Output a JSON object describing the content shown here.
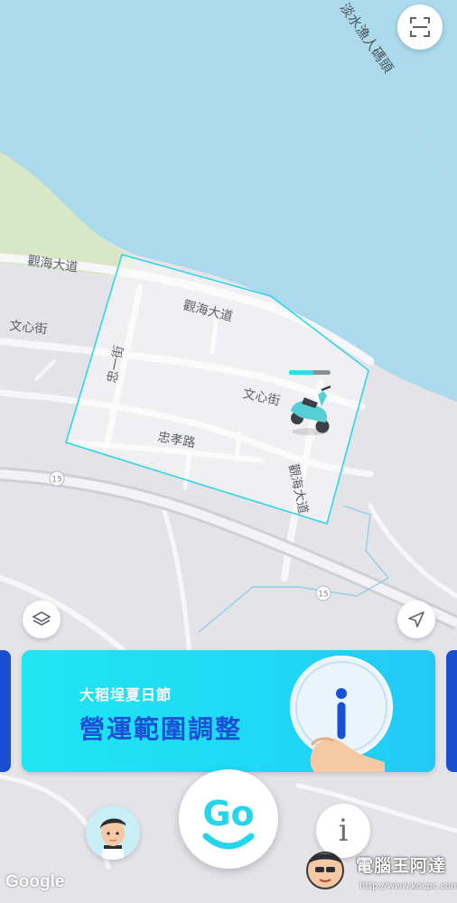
{
  "map": {
    "labels": {
      "harbor_ferry": "淡水漁人碼頭",
      "guanhai_left": "觀海大道",
      "guanhai_top": "觀海大道",
      "guanhai_right": "觀海大道",
      "wenxin_left": "文心街",
      "wenxin_right": "文心街",
      "zhongyi": "忠一街",
      "zhongxiao": "忠孝路",
      "route_15_a": "15",
      "route_15_b": "15"
    },
    "zone_color": "#2fd6e8",
    "water_color": "#aadaec",
    "scooter_battery_level": 0.6
  },
  "banner": {
    "subtitle": "大稻埕夏日節",
    "title": "營運範圍調整",
    "info_glyph": "i"
  },
  "bottom_bar": {
    "go_label": "Go",
    "info_label": "i"
  },
  "attribution": {
    "google": "Google"
  },
  "watermark": {
    "name": "電腦王阿達",
    "url": "http://www.kocpc.com.tw"
  },
  "colors": {
    "accent_cyan": "#1fe3f3",
    "brand_blue": "#1a4fd8",
    "icon_gray": "#6a6f76"
  }
}
